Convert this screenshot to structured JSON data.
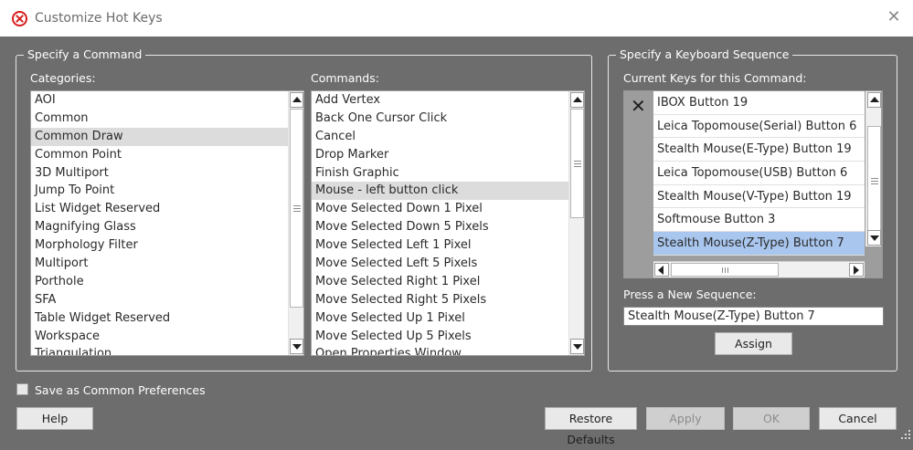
{
  "window": {
    "title": "Customize Hot Keys",
    "close_glyph": "✕",
    "app_icon": "prohibited-circle-icon"
  },
  "command_group": {
    "legend": "Specify a Command",
    "categories_label": "Categories:",
    "commands_label": "Commands:",
    "categories": [
      "AOI",
      "Common",
      "Common Draw",
      "Common Point",
      "3D Multiport",
      "Jump To Point",
      "List Widget Reserved",
      "Magnifying Glass",
      "Morphology Filter",
      "Multiport",
      "Porthole",
      "SFA",
      "Table Widget Reserved",
      "Workspace",
      "Triangulation"
    ],
    "selected_category": "Common Draw",
    "commands": [
      "Add Vertex",
      "Back One Cursor Click",
      "Cancel",
      "Drop Marker",
      "Finish Graphic",
      "Mouse - left button click",
      "Move Selected Down 1 Pixel",
      "Move Selected Down 5 Pixels",
      "Move Selected Left 1 Pixel",
      "Move Selected Left 5 Pixels",
      "Move Selected Right 1 Pixel",
      "Move Selected Right 5 Pixels",
      "Move Selected Up 1 Pixel",
      "Move Selected Up 5 Pixels",
      "Open Properties Window"
    ],
    "selected_command": "Mouse - left button click"
  },
  "keyboard_group": {
    "legend": "Specify a Keyboard Sequence",
    "current_keys_label": "Current Keys for this Command:",
    "remove_glyph": "✕",
    "current_keys": [
      "IBOX Button 19",
      "Leica Topomouse(Serial) Button 6",
      "Stealth Mouse(E-Type) Button 19",
      "Leica Topomouse(USB) Button 6",
      "Stealth Mouse(V-Type) Button 19",
      "Softmouse Button 3",
      "Stealth Mouse(Z-Type) Button 7"
    ],
    "selected_key": "Stealth Mouse(Z-Type) Button 7",
    "new_sequence_label": "Press a New Sequence:",
    "new_sequence_value": "Stealth Mouse(Z-Type) Button 7",
    "assign_label": "Assign"
  },
  "footer": {
    "save_common_label": "Save as Common Preferences",
    "save_common_checked": false,
    "help_label": "Help",
    "restore_label": "Restore Defaults",
    "apply_label": "Apply",
    "ok_label": "OK",
    "cancel_label": "Cancel"
  },
  "colors": {
    "dialog_bg": "#6d6d6d",
    "selection_key": "#a9c6ee",
    "selection_list": "#dcdcdc",
    "app_icon_red": "#d81e1e"
  }
}
